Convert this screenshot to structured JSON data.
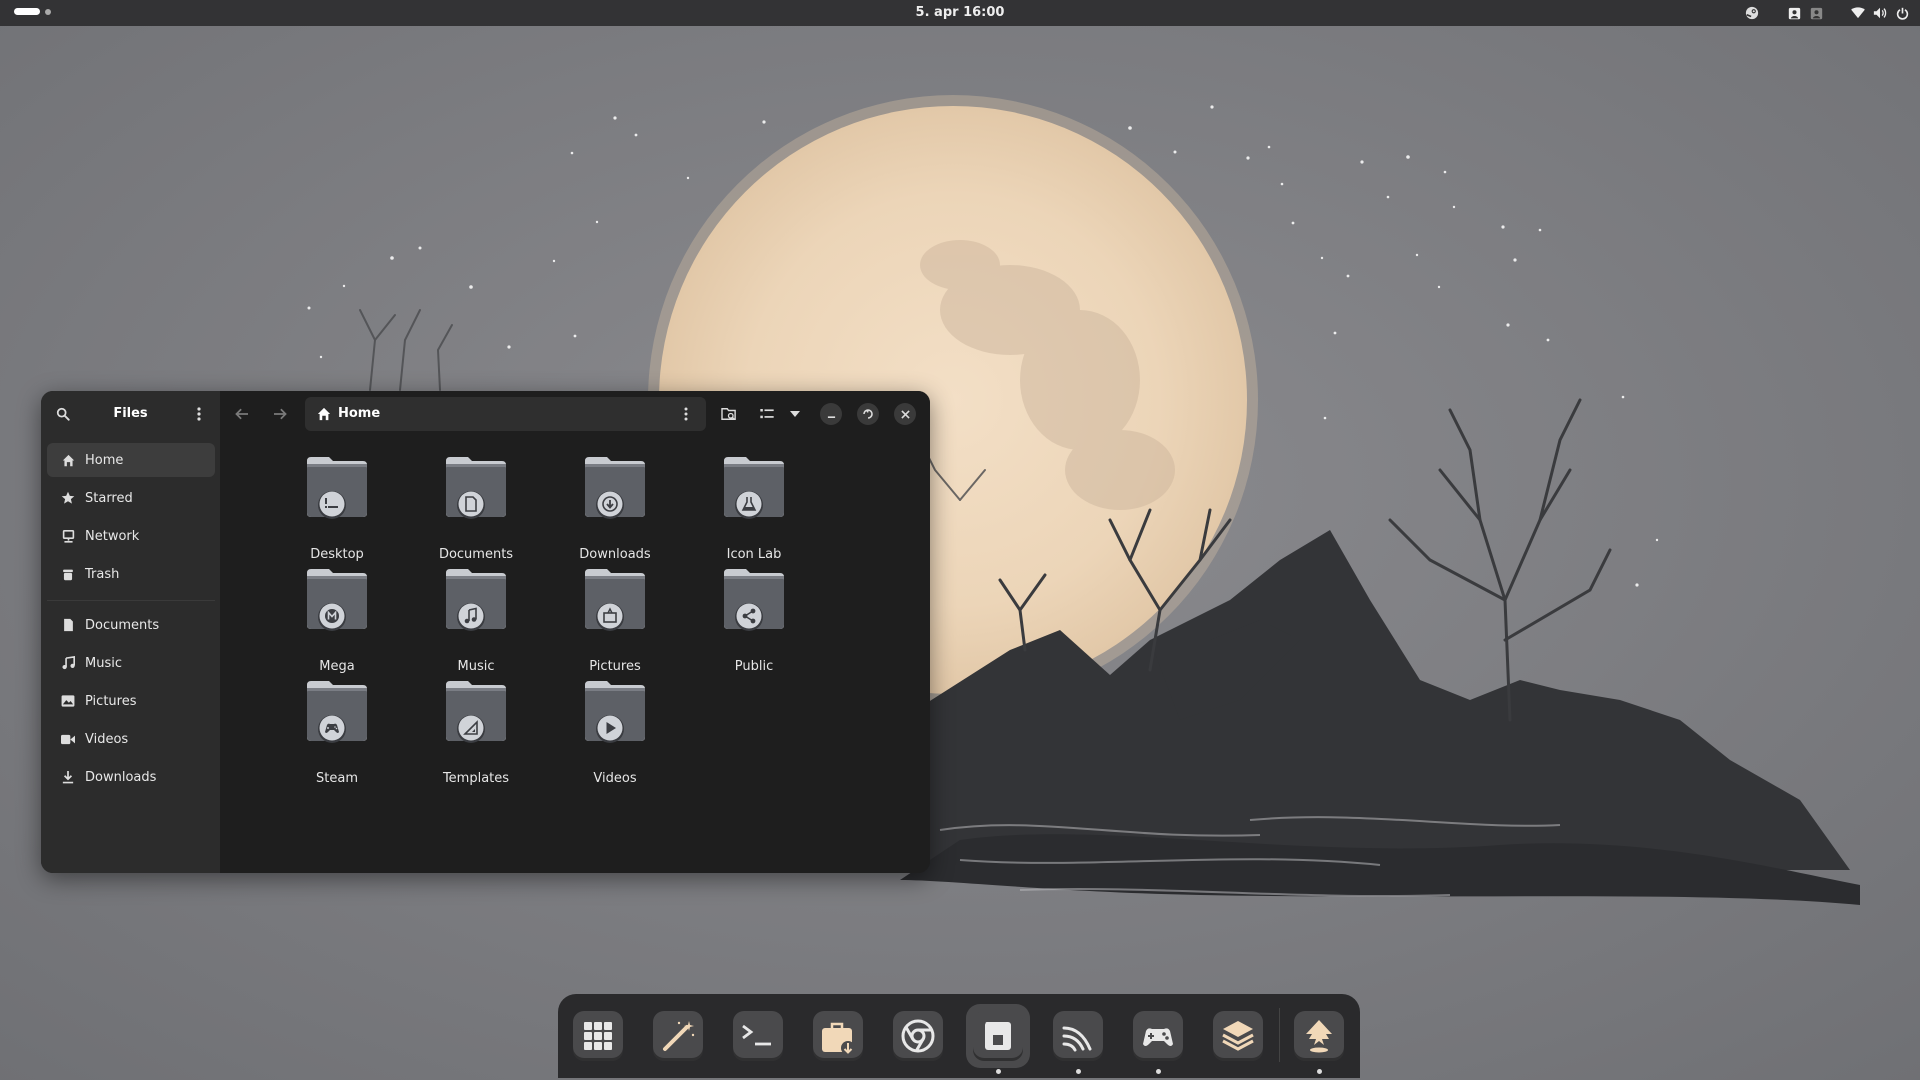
{
  "topbar": {
    "clock": "5. apr  16:00",
    "tray_icons": [
      "steam-icon",
      "user-avatar-icon",
      "user-avatar-dim-icon",
      "wifi-icon",
      "volume-icon",
      "power-icon"
    ]
  },
  "colors": {
    "panel": "#333335",
    "sidebar": "#2c2c2c",
    "content": "#1e1e1e",
    "folder_tab": "#c8cbd0",
    "folder_body": "#5d6066",
    "emblem": "#d0d3d8",
    "moon": "#efd9bd",
    "dock": "#2a2a2c"
  },
  "files": {
    "title": "Files",
    "path": "Home",
    "sidebar": {
      "places": [
        {
          "label": "Home",
          "icon": "home-icon",
          "active": true
        },
        {
          "label": "Starred",
          "icon": "star-icon",
          "active": false
        },
        {
          "label": "Network",
          "icon": "network-icon",
          "active": false
        },
        {
          "label": "Trash",
          "icon": "trash-icon",
          "active": false
        }
      ],
      "bookmarks": [
        {
          "label": "Documents",
          "icon": "document-icon"
        },
        {
          "label": "Music",
          "icon": "music-icon"
        },
        {
          "label": "Pictures",
          "icon": "pictures-icon"
        },
        {
          "label": "Videos",
          "icon": "videos-icon"
        },
        {
          "label": "Downloads",
          "icon": "download-icon"
        }
      ]
    },
    "folders": [
      {
        "label": "Desktop",
        "emblem": "desktop-icon"
      },
      {
        "label": "Documents",
        "emblem": "document-icon"
      },
      {
        "label": "Downloads",
        "emblem": "download-icon"
      },
      {
        "label": "Icon Lab",
        "emblem": "flask-icon"
      },
      {
        "label": "Mega",
        "emblem": "mega-icon"
      },
      {
        "label": "Music",
        "emblem": "music-icon"
      },
      {
        "label": "Pictures",
        "emblem": "pictures-icon"
      },
      {
        "label": "Public",
        "emblem": "share-icon"
      },
      {
        "label": "Steam",
        "emblem": "gamepad-icon"
      },
      {
        "label": "Templates",
        "emblem": "template-icon"
      },
      {
        "label": "Videos",
        "emblem": "play-icon"
      }
    ]
  },
  "dock": {
    "apps": [
      {
        "name": "app-grid-icon",
        "running": false,
        "focused": false
      },
      {
        "name": "magic-wand-icon",
        "running": false,
        "focused": false
      },
      {
        "name": "terminal-icon",
        "running": false,
        "focused": false
      },
      {
        "name": "software-store-icon",
        "running": false,
        "focused": false
      },
      {
        "name": "chrome-icon",
        "running": false,
        "focused": false
      },
      {
        "name": "files-icon",
        "running": true,
        "focused": true
      },
      {
        "name": "rss-feed-icon",
        "running": true,
        "focused": false
      },
      {
        "name": "gamepad-icon",
        "running": true,
        "focused": false
      },
      {
        "name": "layers-icon",
        "running": false,
        "focused": false
      },
      {
        "name": "inkscape-icon",
        "running": true,
        "focused": false
      }
    ]
  }
}
